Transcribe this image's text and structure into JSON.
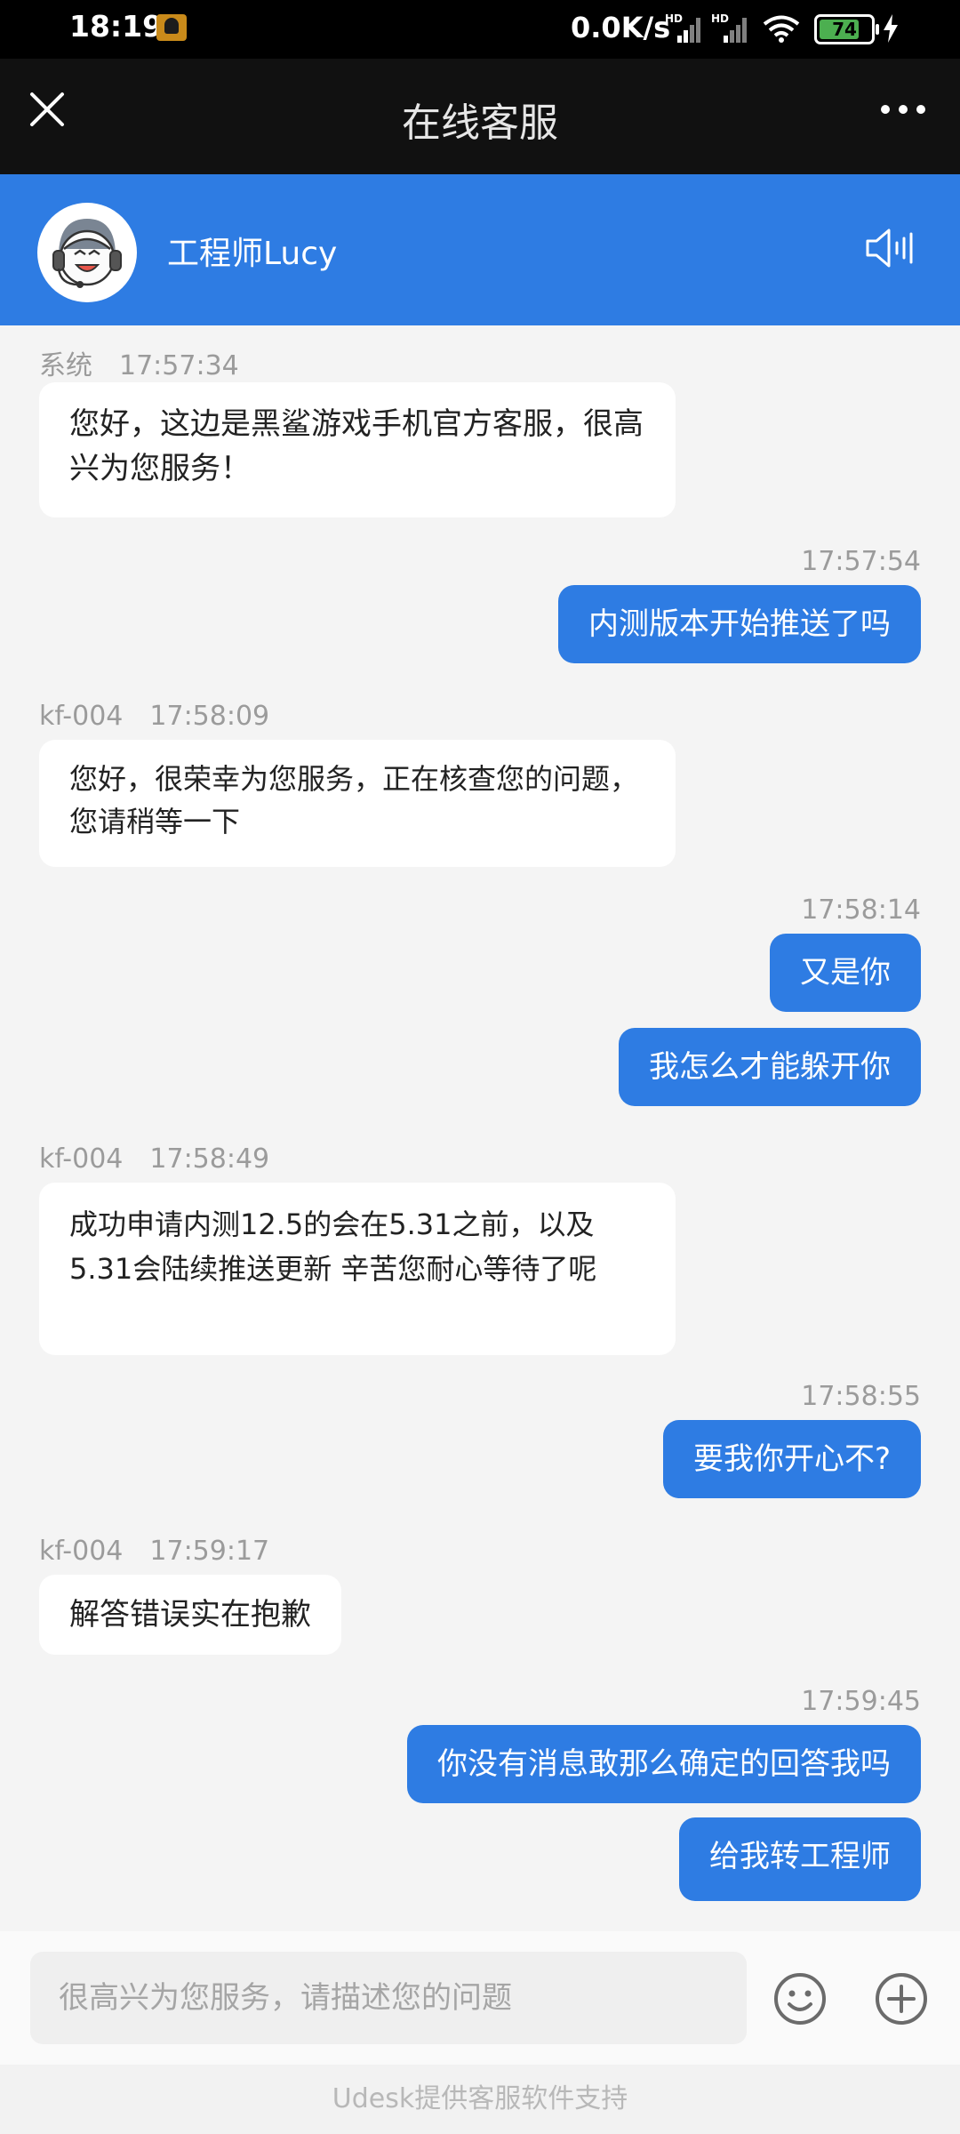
{
  "status_bar": {
    "time": "18:19",
    "net_speed": "0.0K/s",
    "signal_label": "HD",
    "battery": "74"
  },
  "nav": {
    "title": "在线客服"
  },
  "agent": {
    "name": "工程师Lucy"
  },
  "messages": [
    {
      "sender": "系统",
      "time": "17:57:34",
      "text": "您好，这边是黑鲨游戏手机官方客服，很高兴为您服务！"
    },
    {
      "time": "17:57:54",
      "text": "内测版本开始推送了吗"
    },
    {
      "sender": "kf-004",
      "time": "17:58:09",
      "text": "您好，很荣幸为您服务，正在核查您的问题，您请稍等一下"
    },
    {
      "time": "17:58:14",
      "text": "又是你"
    },
    {
      "text": "我怎么才能躲开你"
    },
    {
      "sender": "kf-004",
      "time": "17:58:49",
      "text": "成功申请内测12.5的会在5.31之前，以及5.31会陆续推送更新 辛苦您耐心等待了呢"
    },
    {
      "time": "17:58:55",
      "text": "要我你开心不?"
    },
    {
      "sender": "kf-004",
      "time": "17:59:17",
      "text": "解答错误实在抱歉"
    },
    {
      "time": "17:59:45",
      "text": "你没有消息敢那么确定的回答我吗"
    },
    {
      "text": "给我转工程师"
    }
  ],
  "input": {
    "placeholder": "很高兴为您服务，请描述您的问题",
    "value": ""
  },
  "footer": {
    "text": "Udesk提供客服软件支持"
  },
  "colors": {
    "accent": "#2e7ce3",
    "nav_bg": "#111111",
    "chat_bg": "#f4f4f4"
  }
}
